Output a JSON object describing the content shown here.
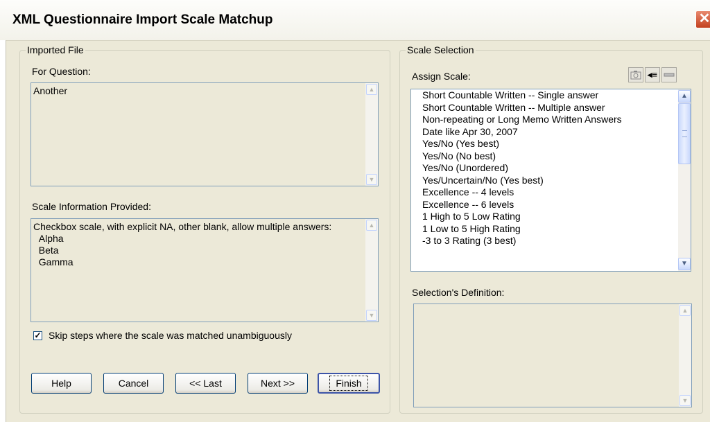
{
  "window": {
    "title": "XML Questionnaire Import Scale Matchup",
    "close_glyph": "✕"
  },
  "imported_file": {
    "legend": "Imported File",
    "for_question_label": "For Question:",
    "question_text": "Another",
    "scale_info_label": "Scale Information Provided:",
    "scale_info_text": "Checkbox scale, with explicit NA, other blank, allow multiple answers:\n  Alpha\n  Beta\n  Gamma",
    "skip_checkbox": {
      "checked": true,
      "label": "Skip steps where the scale was matched unambiguously"
    }
  },
  "buttons": {
    "help": "Help",
    "cancel": "Cancel",
    "last": "<< Last",
    "next": "Next >>",
    "finish": "Finish"
  },
  "scale_selection": {
    "legend": "Scale Selection",
    "assign_label": "Assign Scale:",
    "toolbar_icons": [
      "camera-icon",
      "tag-icon",
      "minus-icon"
    ],
    "scales": [
      "Short Countable Written -- Single answer",
      "Short Countable Written -- Multiple answer",
      "Non-repeating or Long Memo Written Answers",
      "Date like Apr 30, 2007",
      "Yes/No (Yes best)",
      "Yes/No (No best)",
      "Yes/No (Unordered)",
      "Yes/Uncertain/No (Yes best)",
      "Excellence -- 4 levels",
      "Excellence -- 6 levels",
      "1 High to 5 Low Rating",
      "1 Low to 5 High Rating",
      "-3 to 3 Rating (3 best)"
    ],
    "definition_label": "Selection's Definition:",
    "definition_text": ""
  }
}
